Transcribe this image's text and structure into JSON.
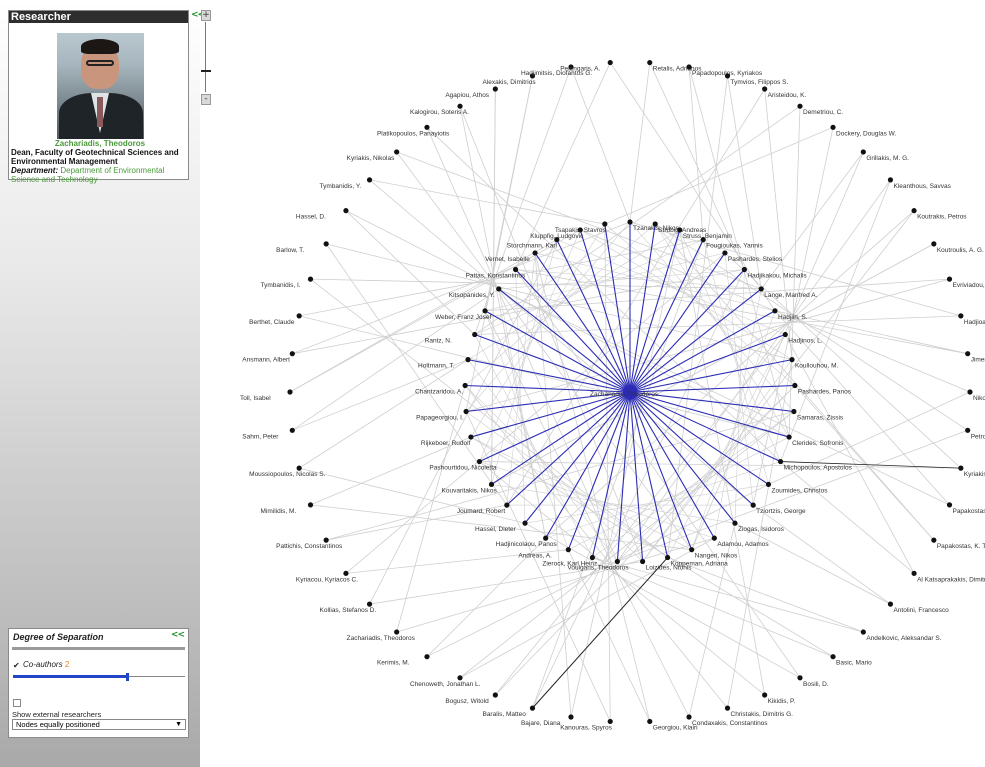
{
  "researcher_panel": {
    "header": "Researcher",
    "collapse_label": "<<",
    "name": "Zachariadis, Theodoros",
    "title": "Dean, Faculty of Geotechnical Sciences and Environmental Management",
    "department_label": "Department:",
    "department": "Department of Environmental Science and Technology"
  },
  "zoom": {
    "plus": "+",
    "minus": "-",
    "level": 0.68
  },
  "dos_panel": {
    "title": "Degree of Separation",
    "collapse_label": "<<",
    "coauthors_check": "✔",
    "coauthors_label": "Co-authors",
    "coauthors_value": "2",
    "slider_fraction": 0.66,
    "show_external": "Show external researchers",
    "layout_selected": "Nodes equally positioned",
    "layout_arrow": "▼"
  },
  "graph": {
    "center_label": "Zachariadis, Theodoros",
    "colors": {
      "edge": "#cfcfcf",
      "direct": "#2b2bb5",
      "node": "#111111",
      "highlight": "#222222"
    },
    "inner": [
      "Tzanakis, Nikos",
      "Strubig, Andreas",
      "Struss, Benjamin",
      "Fougioukas, Yannis",
      "Pashardes, Stelios",
      "Hadjikakou, Michalis",
      "Lange, Manfred A.",
      "Hadjiin, S.",
      "Hadjinos, L.",
      "Koullouhou, M.",
      "Pashardes, Panos",
      "Samaras, Zissis",
      "Clerides, Sofronis",
      "Michopoulos, Apostolos",
      "Zoumides, Christos",
      "Tziortzis, George",
      "Ziogas, Isidoros",
      "Adamou, Adamos",
      "Nangeri, Nikos",
      "Koppeman, Adriana",
      "Loizides, Ntonis",
      "Voulgaris, Theodoros",
      "Zierock, Karl Heinz",
      "Andreas, A.",
      "Hadjinicolaou, Panos",
      "Hassel, Dieter",
      "Joumard, Robert",
      "Kouvaritakis, Nikos",
      "Pashourtidou, Nicoletta",
      "Rijkeboer, Rudolf",
      "Papageorgiou, I.",
      "Chantzaridou, A.",
      "Holtmann, T.",
      "Rantz, N.",
      "Weber, Franz Josef",
      "Kitsopanides, Y.",
      "Pattas, Konstantinos",
      "Vernet, Isabelle",
      "Storchmann, Karl",
      "Kluppfig, Ludgovic",
      "Tsapakis, Stavros"
    ],
    "outer": [
      "Retalis, Adrianos",
      "Papadopoulos, Kyriakos",
      "Tymvios, Filippos S.",
      "Aristeidou, K.",
      "Demetriou, C.",
      "Dockery, Douglas W.",
      "Grillakis, M. G.",
      "Kleanthous, Savvas",
      "Koutrakis, Petros",
      "Koutroulis, A. G.",
      "Evriviadou, Marina",
      "Hadjioannou, Louis",
      "Jimenez, Carlos",
      "Nikolaidis, Andreas",
      "Petrou, Antonis",
      "Kyriakis, N. A.",
      "Papakostas, K.",
      "Papakostas, K. T.",
      "Al Katsaprakakis, Dimitris",
      "Antolini, Francesco",
      "Andelkovic, Aleksandar S.",
      "Basic, Mario",
      "Bosili, D.",
      "Kikidis, P.",
      "Christakis, Dimitris G.",
      "Condaxakis, Constantinos",
      "Georgiou, Klairi",
      "Kanouras, Spyros",
      "Bajare, Diana",
      "Baralis, Matteo",
      "Bogusz, Witold",
      "Chenoweth, Jonathan L.",
      "Kerimis, M.",
      "Zachariadis, Theodoros",
      "Kollias, Stefanos D.",
      "Kyriacou, Kyriacos C.",
      "Pattichis, Constantinos",
      "Mimilidis, M.",
      "Moussiopoulos, Nicolas S.",
      "Sahm, Peter",
      "Toll, Isabel",
      "Ansmann, Albert",
      "Berthet, Claude",
      "Tymbanidis, I.",
      "Barlow, T.",
      "Hassel, D.",
      "Tymbanidis, Y.",
      "Kyriakis, Nikolas",
      "Platikopoulos, Panayiotis",
      "Kalogirou, Soteris A.",
      "Agapiou, Athos",
      "Alexakis, Dimitrios",
      "Hadjimitsis, Diofantos G.",
      "Pelengaris, A."
    ]
  }
}
